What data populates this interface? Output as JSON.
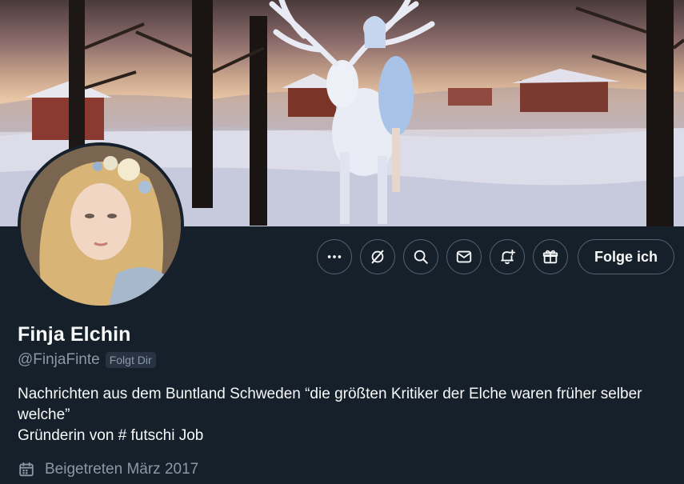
{
  "profile": {
    "display_name": "Finja Elchin",
    "handle": "@FinjaFinte",
    "follows_you_badge": "Folgt Dir",
    "bio_line1": "Nachrichten aus dem Buntland Schweden  “die größten Kritiker der Elche waren früher selber welche”",
    "bio_line2": "Gründerin von # futschi Job",
    "joined": "Beigetreten März 2017"
  },
  "actions": {
    "more_icon": "more-horizontal-icon",
    "grok_icon": "grok-icon",
    "search_icon": "search-icon",
    "message_icon": "envelope-icon",
    "notify_icon": "bell-plus-icon",
    "subscribe_icon": "gift-icon",
    "follow_label": "Folge ich"
  },
  "colors": {
    "background": "#15202b",
    "text_primary": "#f7f9f9",
    "text_secondary": "#8b98a5",
    "button_border": "#536471"
  }
}
